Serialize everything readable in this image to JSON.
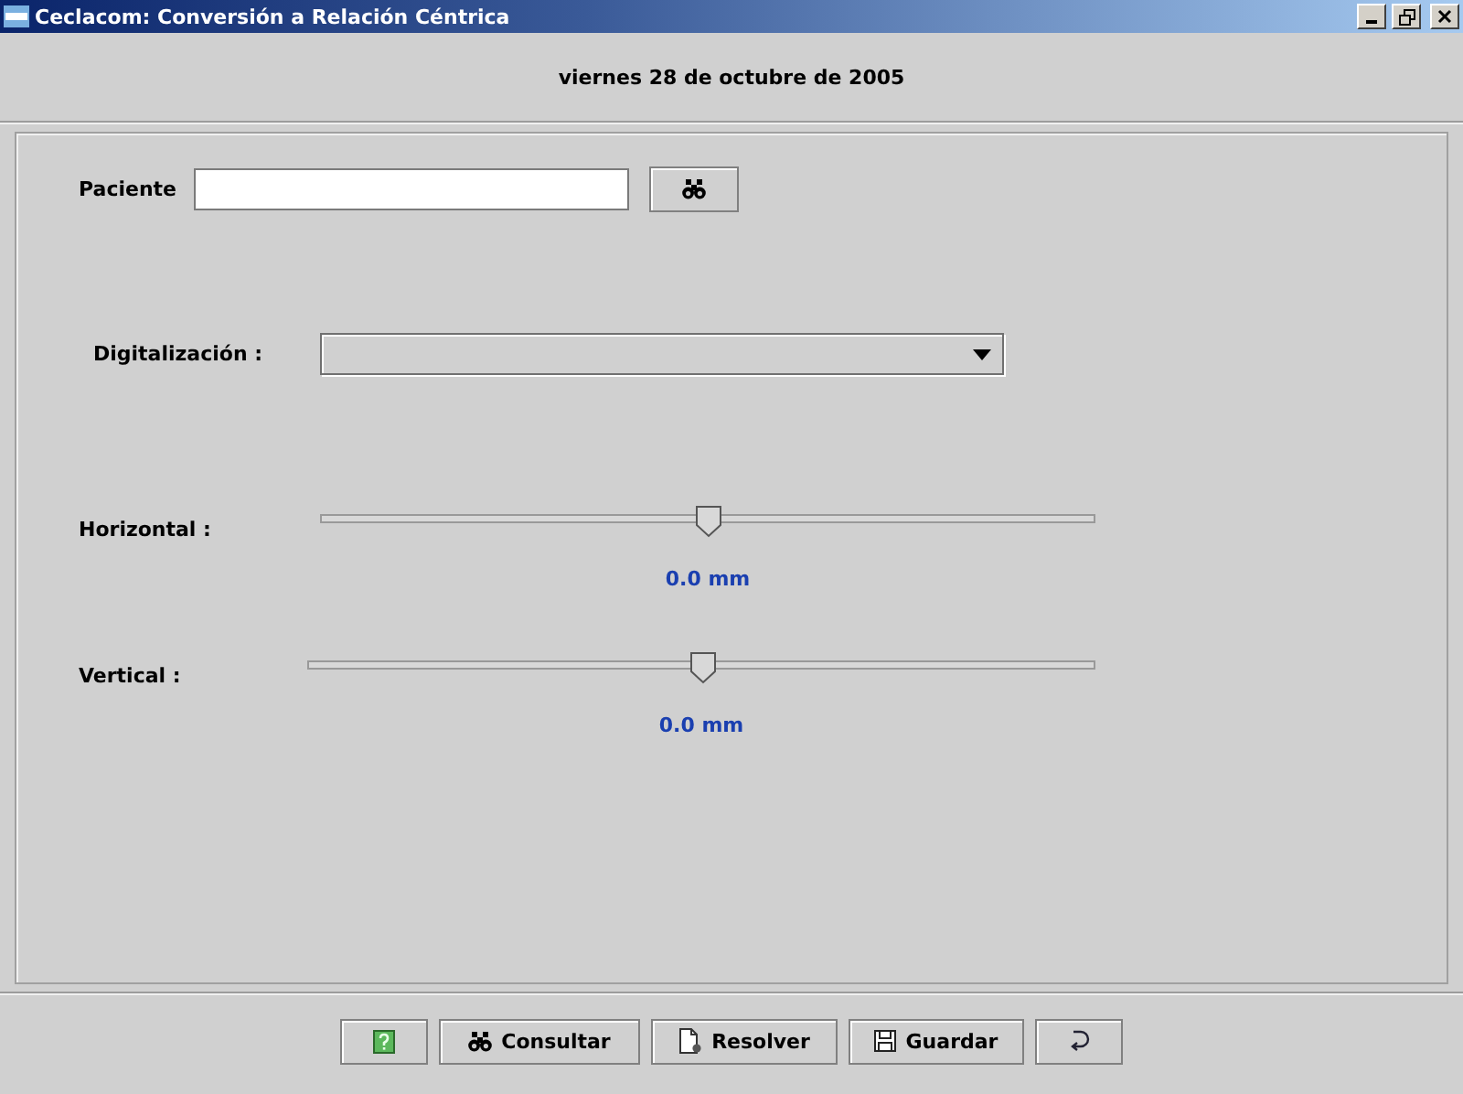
{
  "window": {
    "title": "Ceclacom: Conversión a Relación Céntrica"
  },
  "header": {
    "date": "viernes 28 de octubre de 2005"
  },
  "patient": {
    "label": "Paciente"
  },
  "digitization": {
    "label": "Digitalización :"
  },
  "sliders": [
    {
      "label": "Horizontal :",
      "level": 0.5,
      "reading": "0.0 mm"
    },
    {
      "label": "Vertical :",
      "level": 0.5,
      "reading": "0.0 mm"
    }
  ],
  "buttons": [
    {
      "kind": "help"
    },
    {
      "kind": "search",
      "label": "Consultar"
    },
    {
      "kind": "resolve",
      "label": "Resolver"
    },
    {
      "kind": "save",
      "label": "Guardar"
    },
    {
      "kind": "undo"
    }
  ]
}
